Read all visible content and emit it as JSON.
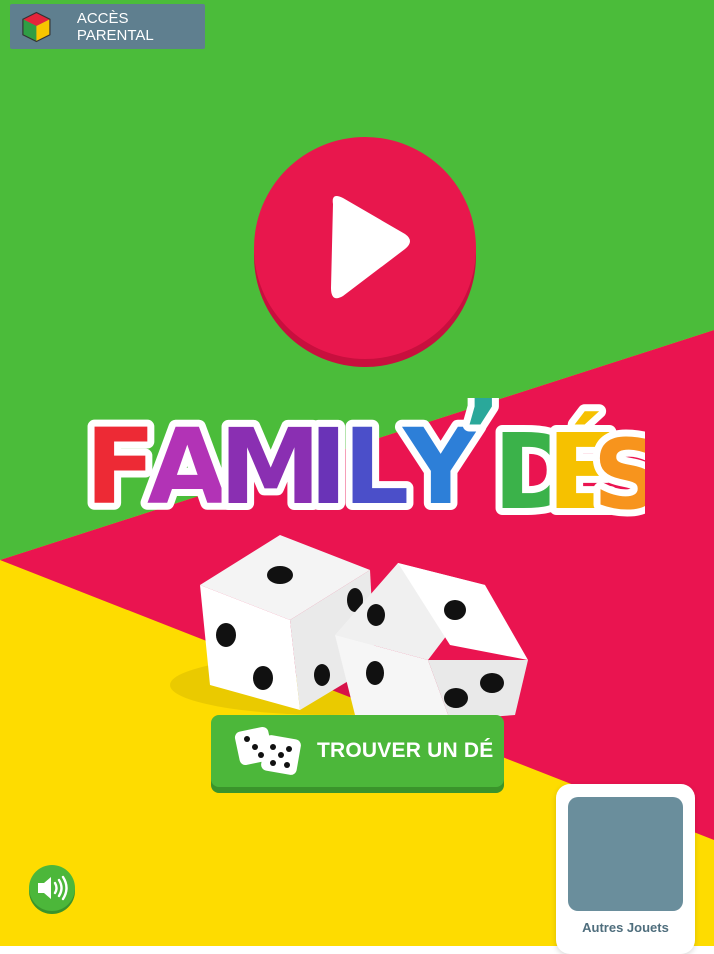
{
  "header": {
    "parental_access_label": "ACCÈS PARENTAL"
  },
  "logo": {
    "text": "FAMILY'DÉS"
  },
  "actions": {
    "find_die_label": "TROUVER UN DÉ"
  },
  "other_toys": {
    "label": "Autres Jouets"
  },
  "icons": {
    "parental": "color-cube-icon",
    "play": "play-icon",
    "dice": "dice-icon",
    "sound": "speaker-icon"
  },
  "colors": {
    "green": "#4bbc3a",
    "magenta": "#ea1450",
    "yellow": "#fedc00",
    "play_red": "#e8174d",
    "button_green": "#4cb73a",
    "badge_slate": "#5f7f8f",
    "thumb_slate": "#6a8e9c"
  }
}
